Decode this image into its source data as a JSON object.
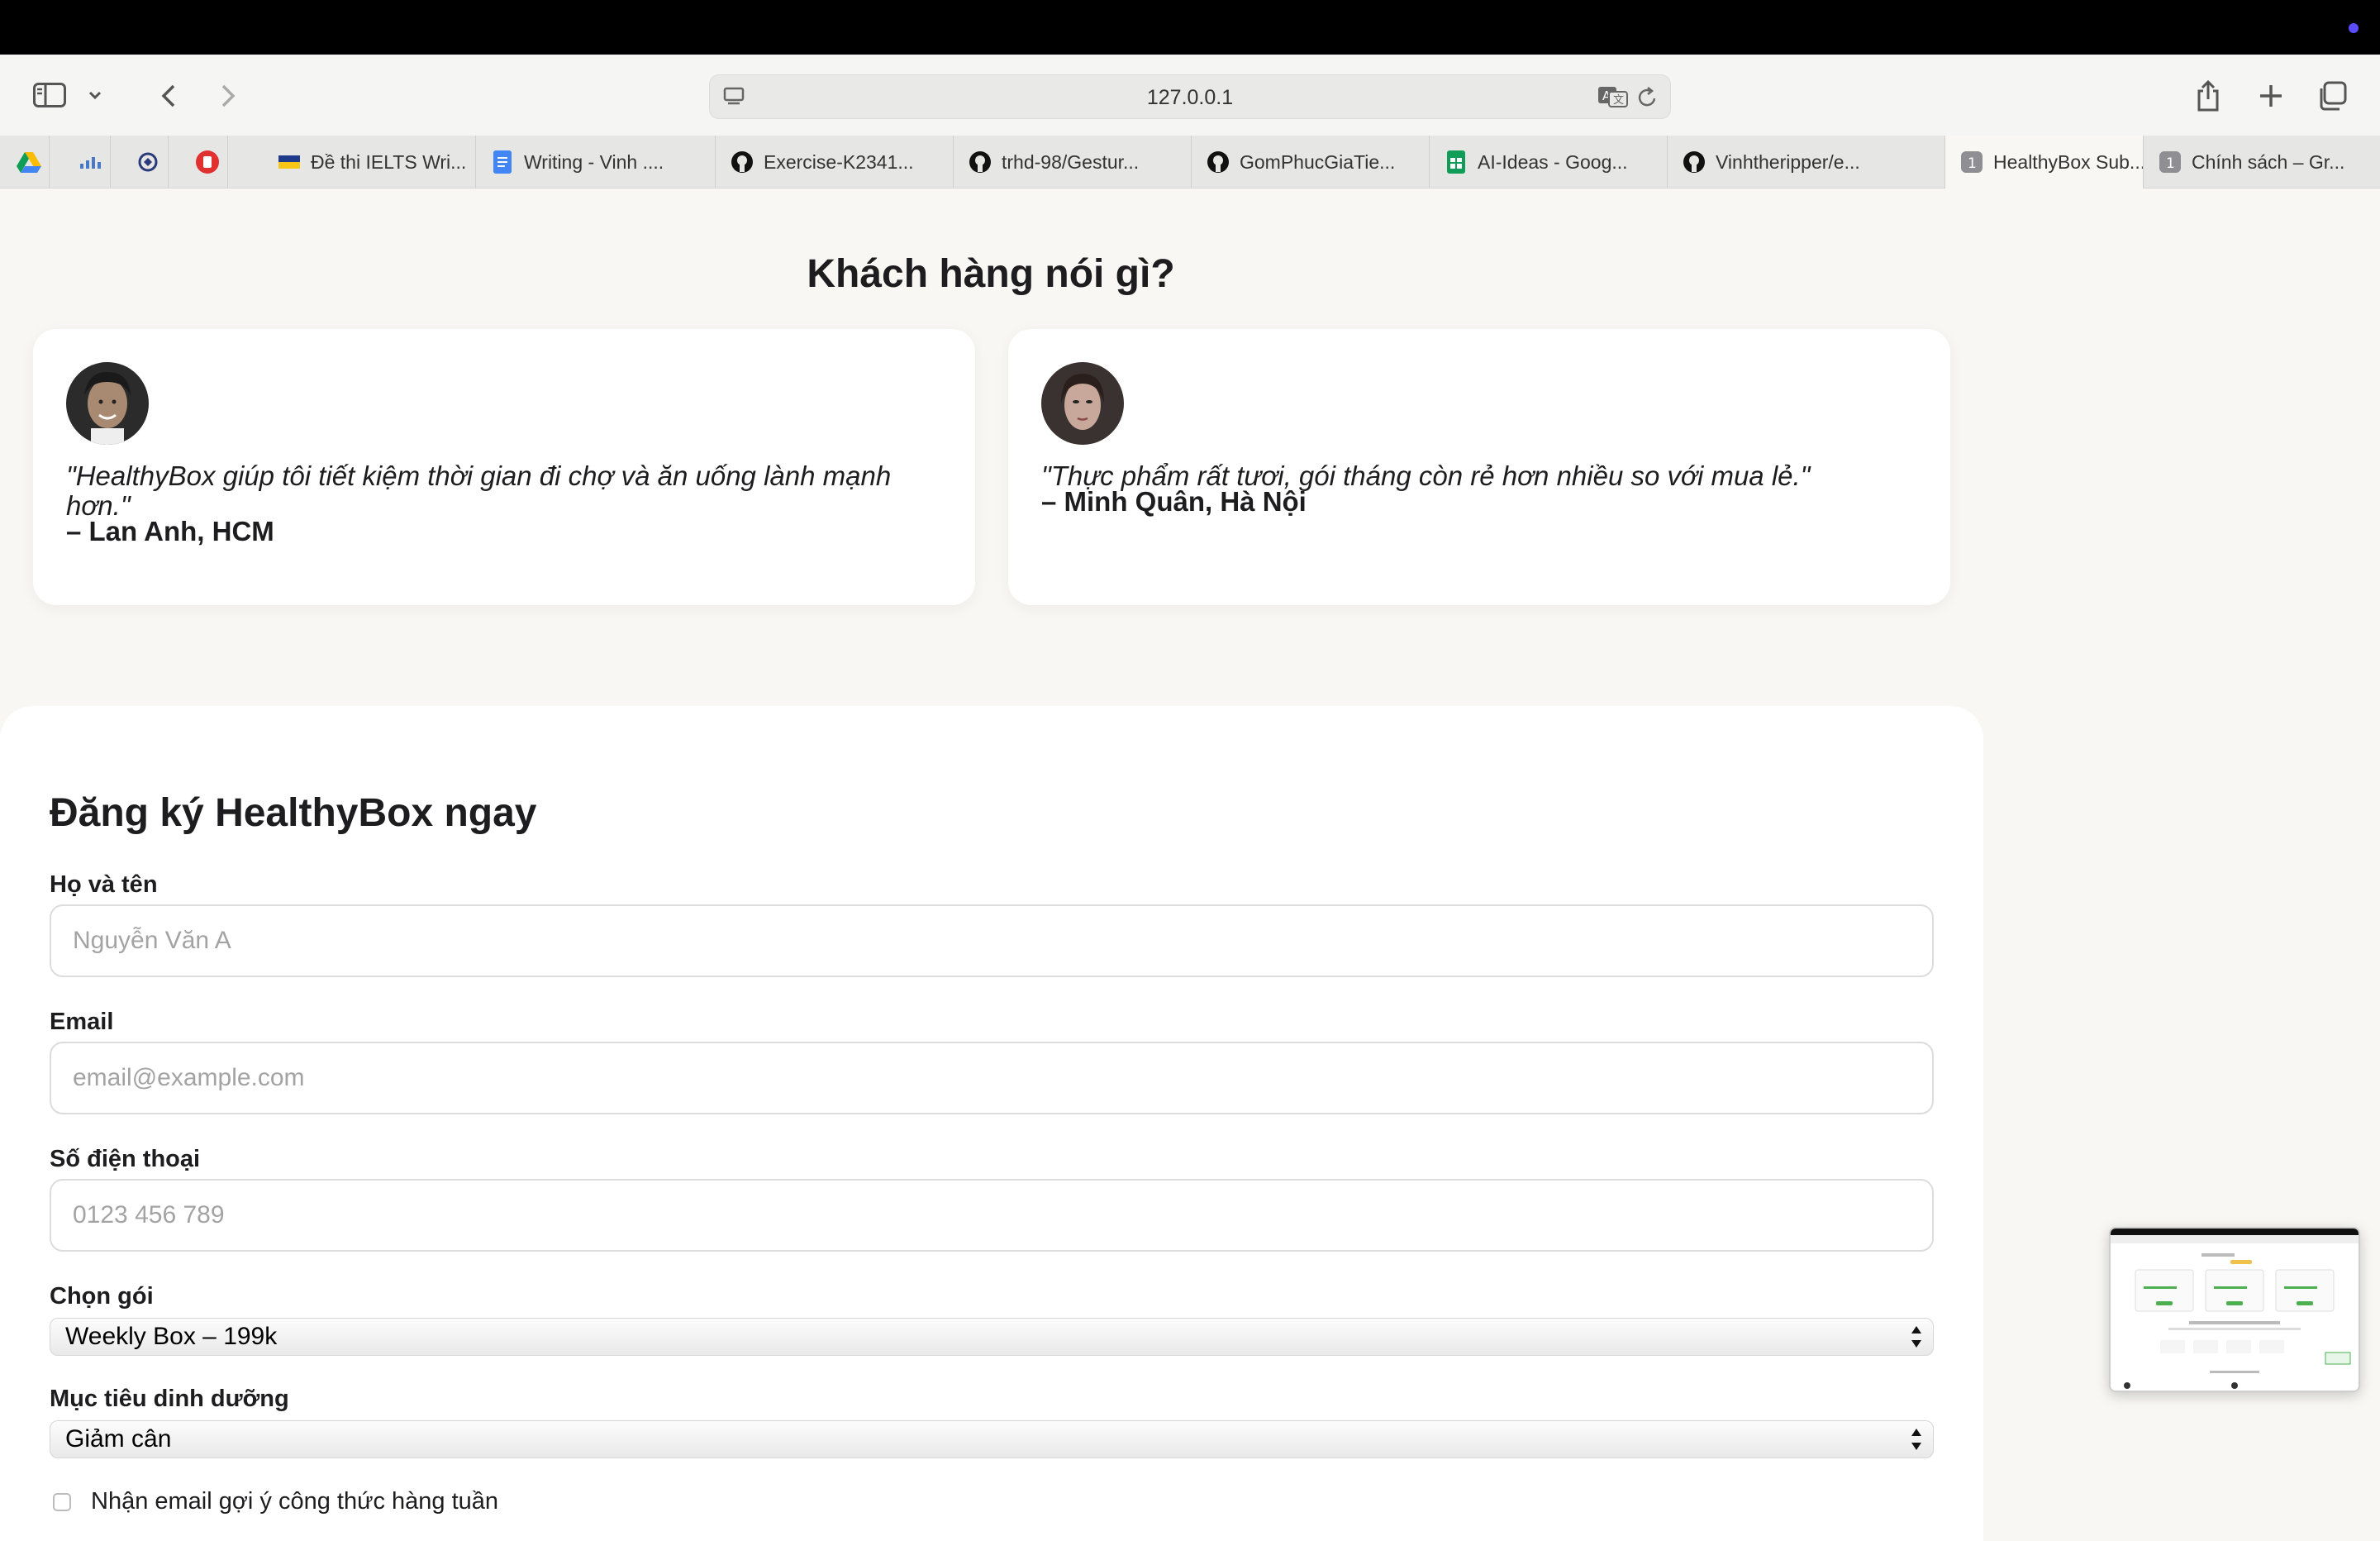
{
  "browser": {
    "url": "127.0.0.1",
    "tabs": [
      {
        "label": "Đề thi IELTS Wri...",
        "icon": "flag-icon"
      },
      {
        "label": "Writing - Vinh ....",
        "icon": "docs-icon"
      },
      {
        "label": "Exercise-K2341...",
        "icon": "github-icon"
      },
      {
        "label": "trhd-98/Gestur...",
        "icon": "github-icon"
      },
      {
        "label": "GomPhucGiaTie...",
        "icon": "github-icon"
      },
      {
        "label": "AI-Ideas - Goog...",
        "icon": "sheets-icon"
      },
      {
        "label": "Vinhtheripper/e...",
        "icon": "github-icon"
      },
      {
        "label": "HealthyBox Sub...",
        "icon": "tab-group-icon",
        "badge": "1"
      },
      {
        "label": "Chính sách – Gr...",
        "icon": "tab-group-icon",
        "badge": "1"
      }
    ]
  },
  "testimonials": {
    "title": "Khách hàng nói gì?",
    "items": [
      {
        "quote": "\"HealthyBox giúp tôi tiết kiệm thời gian đi chợ và ăn uống lành mạnh hơn.\"",
        "author": "– Lan Anh, HCM"
      },
      {
        "quote": "\"Thực phẩm rất tươi, gói tháng còn rẻ hơn nhiều so với mua lẻ.\"",
        "author": "– Minh Quân, Hà Nội"
      }
    ]
  },
  "form": {
    "title": "Đăng ký HealthyBox ngay",
    "name": {
      "label": "Họ và tên",
      "placeholder": "Nguyễn Văn A"
    },
    "email": {
      "label": "Email",
      "placeholder": "email@example.com"
    },
    "phone": {
      "label": "Số điện thoại",
      "placeholder": "0123 456 789"
    },
    "plan": {
      "label": "Chọn gói",
      "value": "Weekly Box – 199k"
    },
    "goal": {
      "label": "Mục tiêu dinh dưỡng",
      "value": "Giảm cân"
    },
    "newsletter": {
      "label": "Nhận email gợi ý công thức hàng tuần"
    }
  }
}
